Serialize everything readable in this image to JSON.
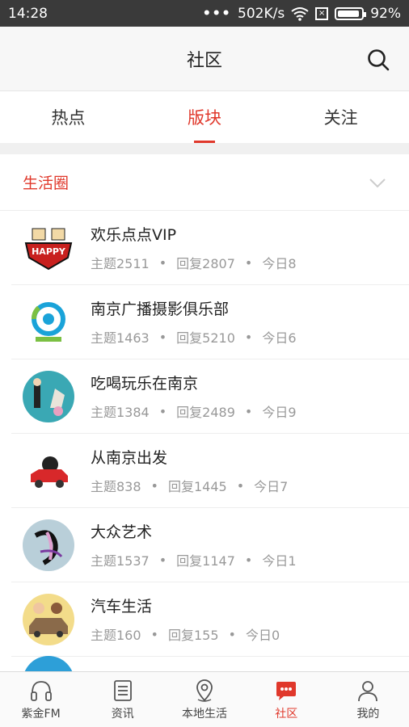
{
  "status_bar": {
    "time": "14:28",
    "network_speed": "502K/s",
    "battery": "92%"
  },
  "header": {
    "title": "社区"
  },
  "tabs": [
    {
      "label": "热点",
      "active": false
    },
    {
      "label": "版块",
      "active": true
    },
    {
      "label": "关注",
      "active": false
    }
  ],
  "section": {
    "label": "生活圈"
  },
  "forums": [
    {
      "name": "欢乐点点VIP",
      "topics": "主题2511",
      "replies": "回复2807",
      "today": "今日8"
    },
    {
      "name": "南京广播摄影俱乐部",
      "topics": "主题1463",
      "replies": "回复5210",
      "today": "今日6"
    },
    {
      "name": "吃喝玩乐在南京",
      "topics": "主题1384",
      "replies": "回复2489",
      "today": "今日9"
    },
    {
      "name": "从南京出发",
      "topics": "主题838",
      "replies": "回复1445",
      "today": "今日7"
    },
    {
      "name": "大众艺术",
      "topics": "主题1537",
      "replies": "回复1147",
      "today": "今日1"
    },
    {
      "name": "汽车生活",
      "topics": "主题160",
      "replies": "回复155",
      "today": "今日0"
    }
  ],
  "meta_separator": "•",
  "bottom_nav": [
    {
      "label": "紫金FM",
      "icon": "headphones-icon"
    },
    {
      "label": "资讯",
      "icon": "news-icon"
    },
    {
      "label": "本地生活",
      "icon": "location-pin-icon"
    },
    {
      "label": "社区",
      "icon": "chat-bubble-icon"
    },
    {
      "label": "我的",
      "icon": "person-icon"
    }
  ],
  "colors": {
    "accent": "#e0382b",
    "status_bar": "#3a3a3a"
  }
}
